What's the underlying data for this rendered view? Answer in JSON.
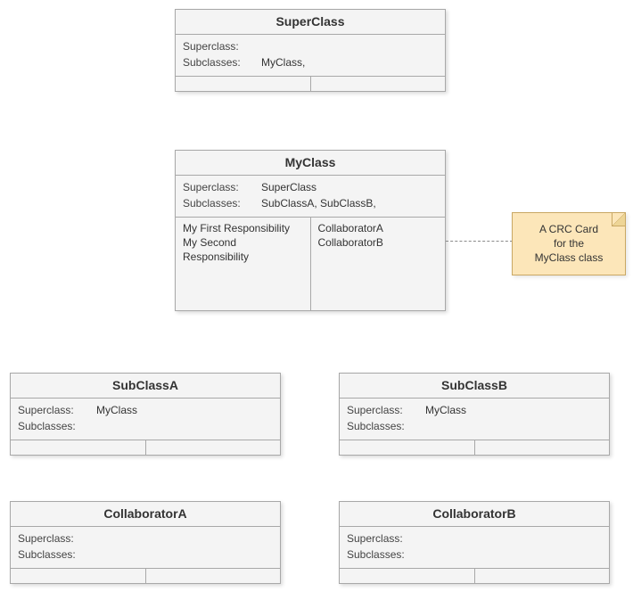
{
  "labels": {
    "superclass": "Superclass:",
    "subclasses": "Subclasses:"
  },
  "note": {
    "line1": "A CRC Card",
    "line2": "for the",
    "line3": "MyClass class"
  },
  "cards": {
    "superclass": {
      "title": "SuperClass",
      "super": "",
      "subs": "MyClass,",
      "resp": "",
      "collab": ""
    },
    "myclass": {
      "title": "MyClass",
      "super": "SuperClass",
      "subs": "SubClassA,   SubClassB,",
      "resp1": "My First Responsibility",
      "resp2": "My Second",
      "resp3": "Responsibility",
      "collab1": "CollaboratorA",
      "collab2": "CollaboratorB"
    },
    "suba": {
      "title": "SubClassA",
      "super": "MyClass",
      "subs": ""
    },
    "subb": {
      "title": "SubClassB",
      "super": "MyClass",
      "subs": ""
    },
    "colla": {
      "title": "CollaboratorA",
      "super": "",
      "subs": ""
    },
    "collb": {
      "title": "CollaboratorB",
      "super": "",
      "subs": ""
    }
  }
}
